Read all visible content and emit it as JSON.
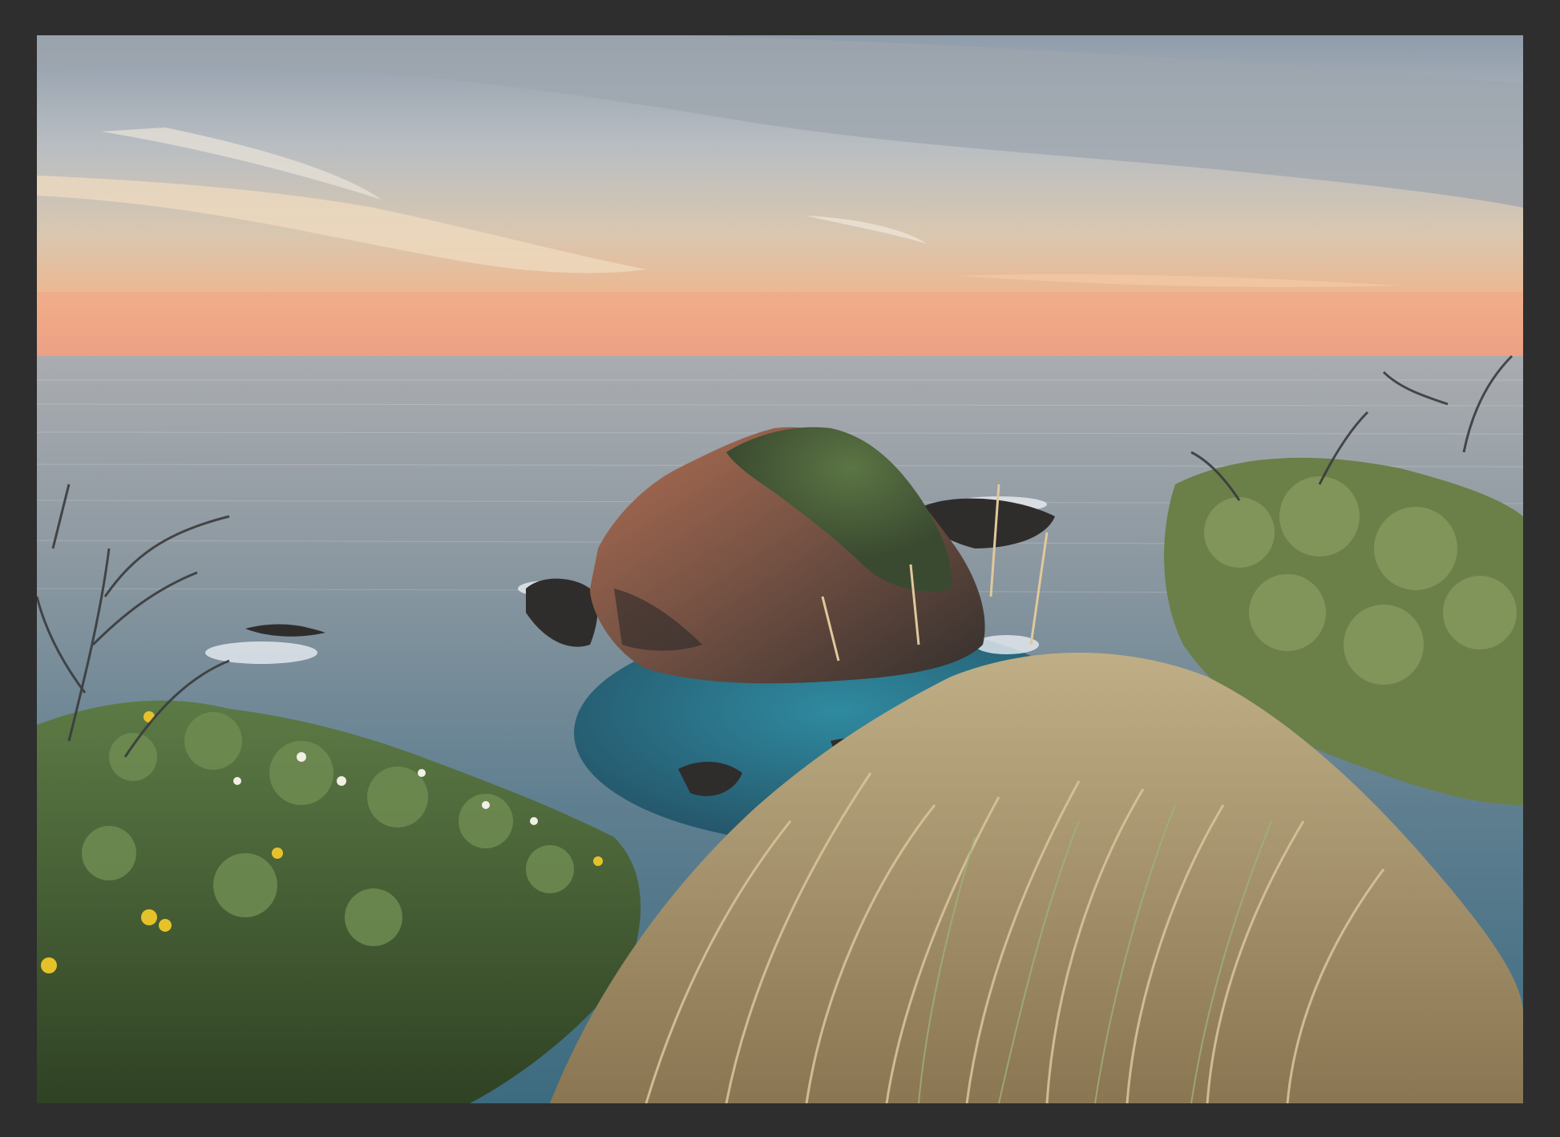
{
  "frame": {
    "color": "#2e2e2e"
  },
  "photo": {
    "subject": "coastal-seascape-at-sunset",
    "colors": {
      "sky_top": "#9aa6b4",
      "sky_mid": "#c9c2b8",
      "sky_horizon": "#f2b98a",
      "horizon_glow": "#f0a27c",
      "sea_far": "#9fa6ad",
      "sea_near": "#3f6f86",
      "lagoon": "#2f7f95",
      "rock_dark": "#3b3734",
      "rock_rust": "#a9684e",
      "rock_moss": "#4f6a3c",
      "grass_dry": "#cdb38a",
      "grass_green": "#7f9a5a",
      "shrub": "#3f5a2e",
      "flower_yellow": "#e6c22a"
    }
  }
}
